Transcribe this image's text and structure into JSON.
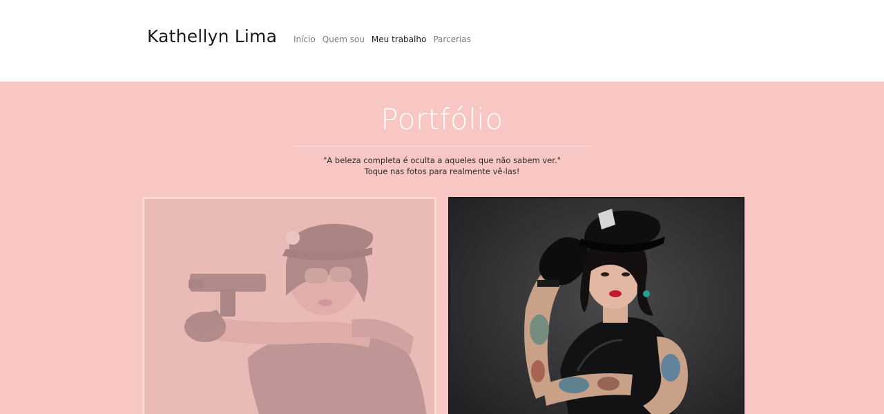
{
  "site": {
    "brand": "Kathellyn Lima"
  },
  "nav": {
    "items": [
      {
        "label": "Início",
        "active": false
      },
      {
        "label": "Quem sou",
        "active": false
      },
      {
        "label": "Meu trabalho",
        "active": true
      },
      {
        "label": "Parcerias",
        "active": false
      }
    ]
  },
  "portfolio": {
    "title": "Portfólio",
    "quote_line1": "\"A beleza completa é oculta a aqueles que não sabem ver.\"",
    "quote_line2": "Toque nas fotos para realmente vê-las!",
    "photos": [
      {
        "subject": "police-costume-aiming-gun",
        "state": "faded"
      },
      {
        "subject": "police-costume-saluting",
        "state": "normal"
      }
    ]
  },
  "colors": {
    "section_background": "#f8c7c3",
    "title_color": "#ffffff",
    "nav_active": "#1a1a1a",
    "nav_inactive": "#7a7a7a"
  }
}
